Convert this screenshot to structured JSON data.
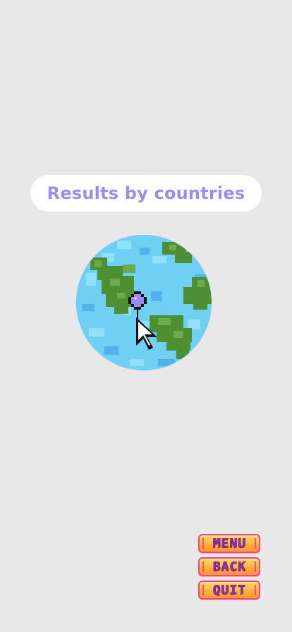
{
  "screen": {
    "title": "Results by countries"
  },
  "illustration": {
    "globe_icon": "globe-icon",
    "pin_icon": "location-pin-icon",
    "cursor_icon": "pointer-cursor-icon",
    "colors": {
      "ocean": "#6fd0f3",
      "ocean_light": "#8fe2ff",
      "ocean_dark": "#52b3ea",
      "land": "#4e8f33",
      "land_light": "#6ea94c",
      "pin": "#9a88f3",
      "outline": "#111111"
    }
  },
  "menu": {
    "items": [
      {
        "label": "MENU"
      },
      {
        "label": "BACK"
      },
      {
        "label": "QUIT"
      }
    ]
  }
}
